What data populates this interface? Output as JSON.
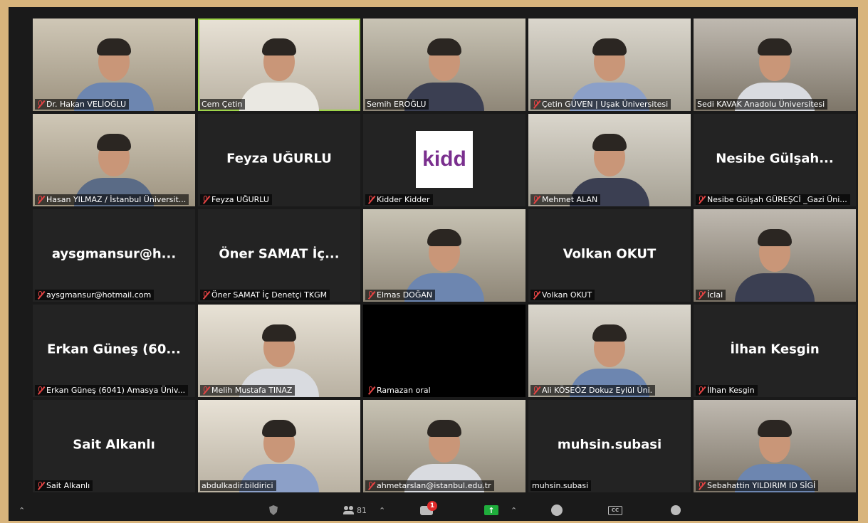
{
  "tiles": [
    {
      "label": "Dr. Hakan VELİOĞLU",
      "muted": true,
      "big": "",
      "kind": "video"
    },
    {
      "label": "Cem Çetin",
      "muted": false,
      "big": "",
      "kind": "video",
      "active": true
    },
    {
      "label": "Semih EROĞLU",
      "muted": false,
      "big": "",
      "kind": "video"
    },
    {
      "label": "Çetin GÜVEN | Uşak Üniversitesi",
      "muted": true,
      "big": "",
      "kind": "video"
    },
    {
      "label": "Sedi KAVAK Anadolu Üniversitesi",
      "muted": false,
      "big": "",
      "kind": "video"
    },
    {
      "label": "Hasan YILMAZ / İstanbul Üniversit...",
      "muted": true,
      "big": "",
      "kind": "video"
    },
    {
      "label": "Feyza UĞURLU",
      "muted": true,
      "big": "Feyza UĞURLU",
      "kind": "name"
    },
    {
      "label": "Kidder Kidder",
      "muted": true,
      "big": "",
      "kind": "logo",
      "logo_text": "kidd"
    },
    {
      "label": "Mehmet ALAN",
      "muted": true,
      "big": "",
      "kind": "video"
    },
    {
      "label": "Nesibe Gülşah GÜREŞCİ _Gazi Üni...",
      "muted": true,
      "big": "Nesibe  Gülşah...",
      "kind": "name"
    },
    {
      "label": "aysgmansur@hotmail.com",
      "muted": true,
      "big": "aysgmansur@h...",
      "kind": "name"
    },
    {
      "label": "Öner SAMAT İç Denetçi TKGM",
      "muted": true,
      "big": "Öner SAMAT  İç...",
      "kind": "name"
    },
    {
      "label": "Elmas DOĞAN",
      "muted": true,
      "big": "",
      "kind": "video"
    },
    {
      "label": "Volkan OKUT",
      "muted": true,
      "big": "Volkan OKUT",
      "kind": "name"
    },
    {
      "label": "İclal",
      "muted": true,
      "big": "",
      "kind": "video"
    },
    {
      "label": "Erkan Güneş (6041) Amasya Üniv...",
      "muted": true,
      "big": "Erkan Güneş (60...",
      "kind": "name"
    },
    {
      "label": "Melih Mustafa TINAZ",
      "muted": true,
      "big": "",
      "kind": "video"
    },
    {
      "label": "Ramazan oral",
      "muted": true,
      "big": "",
      "kind": "black"
    },
    {
      "label": "Ali KÖSEÖZ Dokuz Eylül Üni.",
      "muted": true,
      "big": "",
      "kind": "video"
    },
    {
      "label": "İlhan Kesgin",
      "muted": true,
      "big": "İlhan Kesgin",
      "kind": "name"
    },
    {
      "label": "Sait Alkanlı",
      "muted": true,
      "big": "Sait Alkanlı",
      "kind": "name"
    },
    {
      "label": "abdulkadir.bildirici",
      "muted": false,
      "big": "",
      "kind": "video"
    },
    {
      "label": "ahmetarslan@istanbul.edu.tr",
      "muted": true,
      "big": "",
      "kind": "video"
    },
    {
      "label": "muhsin.subasi",
      "muted": false,
      "big": "muhsin.subasi",
      "kind": "name"
    },
    {
      "label": "Sebahattin YILDIRIM ID SİGİ",
      "muted": true,
      "big": "",
      "kind": "video"
    }
  ],
  "toolbar": {
    "participants_count": "81",
    "chat_badge": "1",
    "cc_label": "CC"
  },
  "colors": {
    "active_border": "#9ed44a",
    "muted_icon": "#e34343",
    "share": "#1fae3c"
  }
}
